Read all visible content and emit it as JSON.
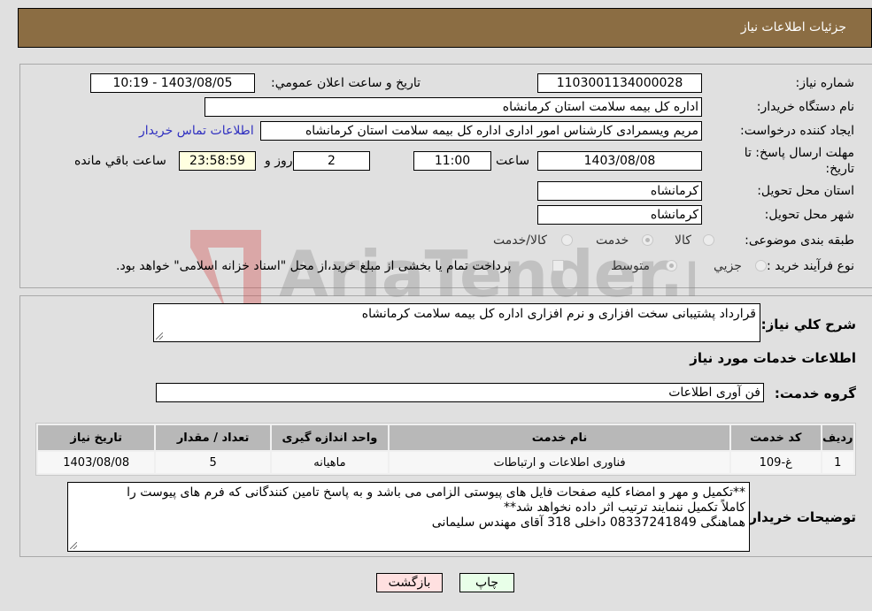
{
  "header": {
    "title": "جزئیات اطلاعات نیاز"
  },
  "form": {
    "need_number": {
      "label": "شماره نیاز:",
      "value": "1103001134000028"
    },
    "announce_datetime": {
      "label": "تاریخ و ساعت اعلان عمومي:",
      "value": "1403/08/05 - 10:19"
    },
    "buyer_org": {
      "label": "نام دستگاه خریدار:",
      "value": "اداره کل بیمه سلامت استان کرمانشاه"
    },
    "requester": {
      "label": "ایجاد کننده درخواست:",
      "value": "مریم ویسمرادی کارشناس امور اداری اداره کل بیمه سلامت استان کرمانشاه"
    },
    "buyer_contact_link": "اطلاعات تماس خریدار",
    "deadline": {
      "label": "مهلت ارسال پاسخ: تا تاریخ:",
      "date": "1403/08/08",
      "time_label": "ساعت",
      "time": "11:00",
      "days": "2",
      "days_label": "روز و",
      "remaining": "23:58:59",
      "remaining_label": "ساعت باقي مانده"
    },
    "delivery_province": {
      "label": "استان محل تحویل:",
      "value": "کرمانشاه"
    },
    "delivery_city": {
      "label": "شهر محل تحویل:",
      "value": "کرمانشاه"
    },
    "category": {
      "label": "طبقه بندی موضوعی:",
      "options": [
        "کالا",
        "خدمت",
        "کالا/خدمت"
      ],
      "selected": "خدمت"
    },
    "purchase_type": {
      "label": "نوع فرآیند خرید :",
      "options": [
        "جزيي",
        "متوسط"
      ],
      "selected": "متوسط",
      "treasury_note": "پرداخت تمام یا بخشی از مبلغ خرید،از محل \"اسناد خزانه اسلامی\" خواهد بود."
    }
  },
  "details": {
    "description_label": "شرح کلي نیاز:",
    "description": "قرارداد پشتیبانی سخت افزاری و نرم افزاری اداره کل بیمه سلامت کرمانشاه",
    "services_heading": "اطلاعات خدمات مورد نیاز",
    "service_group_label": "گروه خدمت:",
    "service_group": "فن آوری اطلاعات",
    "table": {
      "headers": [
        "ردیف",
        "کد خدمت",
        "نام خدمت",
        "واحد اندازه گیری",
        "تعداد / مقدار",
        "تاریخ نیاز"
      ],
      "rows": [
        [
          "1",
          "غ-109",
          "فناوری اطلاعات و ارتباطات",
          "ماهیانه",
          "5",
          "1403/08/08"
        ]
      ]
    },
    "buyer_notes_label": "توضیحات خریدار:",
    "buyer_notes_lines": [
      "**تکمیل و مهر و امضاء کلیه صفحات فایل های پیوستی الزامی می باشد و به پاسخ تامین کنندگانی که فرم های پیوست را",
      "کاملاً تکمیل ننمایند ترتیب اثر داده نخواهد شد**",
      "هماهنگی 08337241849 داخلی 318 آقای مهندس سلیمانی"
    ]
  },
  "buttons": {
    "print": "چاپ",
    "back": "بازگشت"
  },
  "watermark": "AriaTender.neT",
  "colors": {
    "header": "#8b6d43",
    "link": "#3030c0",
    "back_button": "#ffe0e0",
    "print_button": "#e8ffe8",
    "remaining_bg": "#ffffe0"
  }
}
